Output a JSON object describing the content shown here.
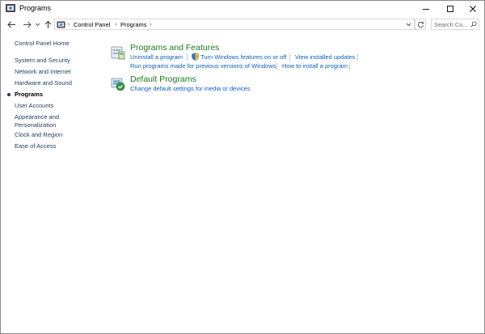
{
  "window": {
    "title": "Programs",
    "minimize_icon": "minimize-icon",
    "maximize_icon": "maximize-icon",
    "close_icon": "close-icon"
  },
  "nav": {
    "breadcrumb": [
      "Control Panel",
      "Programs"
    ],
    "search_placeholder": "Search Co..."
  },
  "sidebar": {
    "items": [
      {
        "label": "Control Panel Home"
      },
      {
        "label": "System and Security"
      },
      {
        "label": "Network and Internet"
      },
      {
        "label": "Hardware and Sound"
      },
      {
        "label": "Programs",
        "active": true
      },
      {
        "label": "User Accounts"
      },
      {
        "label": "Appearance and"
      },
      {
        "label": "Personalization"
      },
      {
        "label": "Clock and Region"
      },
      {
        "label": "Ease of Access"
      }
    ]
  },
  "sections": {
    "programs_features": {
      "title": "Programs and Features",
      "links": [
        "Uninstall a program",
        "Turn Windows features on or off",
        "View installed updates",
        "Run programs made for previous versions of Windows",
        "How to install a program"
      ]
    },
    "default_programs": {
      "title": "Default Programs",
      "links": [
        "Change default settings for media or devices"
      ]
    }
  },
  "colors": {
    "section_title": "#1e7a1e",
    "link": "#0b5fc2",
    "sidebar_text": "#1f3a5a"
  }
}
